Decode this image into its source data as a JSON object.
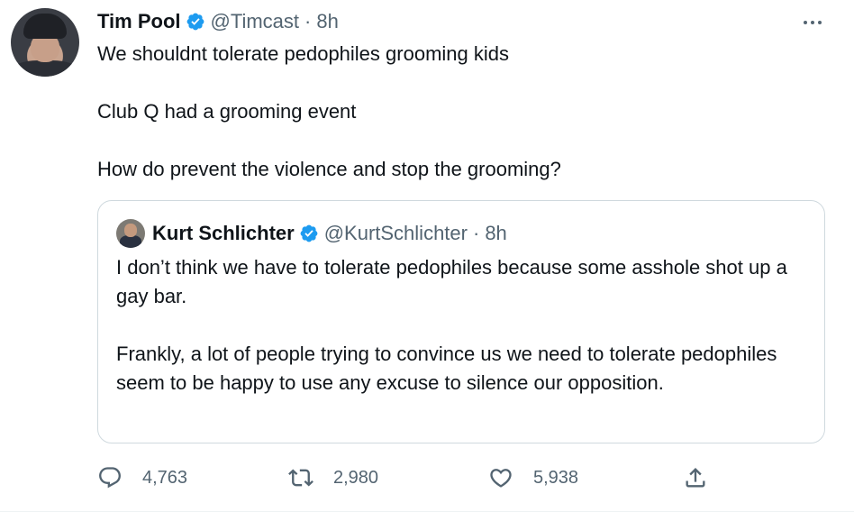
{
  "tweet": {
    "author": {
      "name": "Tim Pool",
      "handle": "@Timcast",
      "time": "8h"
    },
    "lines": [
      "We shouldnt tolerate pedophiles grooming kids",
      "Club Q had a grooming event",
      "How do prevent the violence and stop the grooming?"
    ]
  },
  "quote": {
    "author": {
      "name": "Kurt Schlichter",
      "handle": "@KurtSchlichter",
      "time": "8h"
    },
    "paragraphs": [
      "I don’t think we have to tolerate pedophiles because some asshole shot up a gay bar.",
      "Frankly, a lot of people trying to convince us we need to tolerate pedophiles seem to be happy to use any excuse to silence our opposition."
    ]
  },
  "actions": {
    "reply_count": "4,763",
    "retweet_count": "2,980",
    "like_count": "5,938"
  },
  "meta": {
    "separator": "·",
    "icons": [
      "verified-badge-icon",
      "more-options-icon",
      "reply-icon",
      "retweet-icon",
      "like-icon",
      "share-icon"
    ]
  },
  "colors": {
    "verified": "#1d9bf0",
    "secondary_text": "#536471",
    "border": "#cfd9de"
  }
}
